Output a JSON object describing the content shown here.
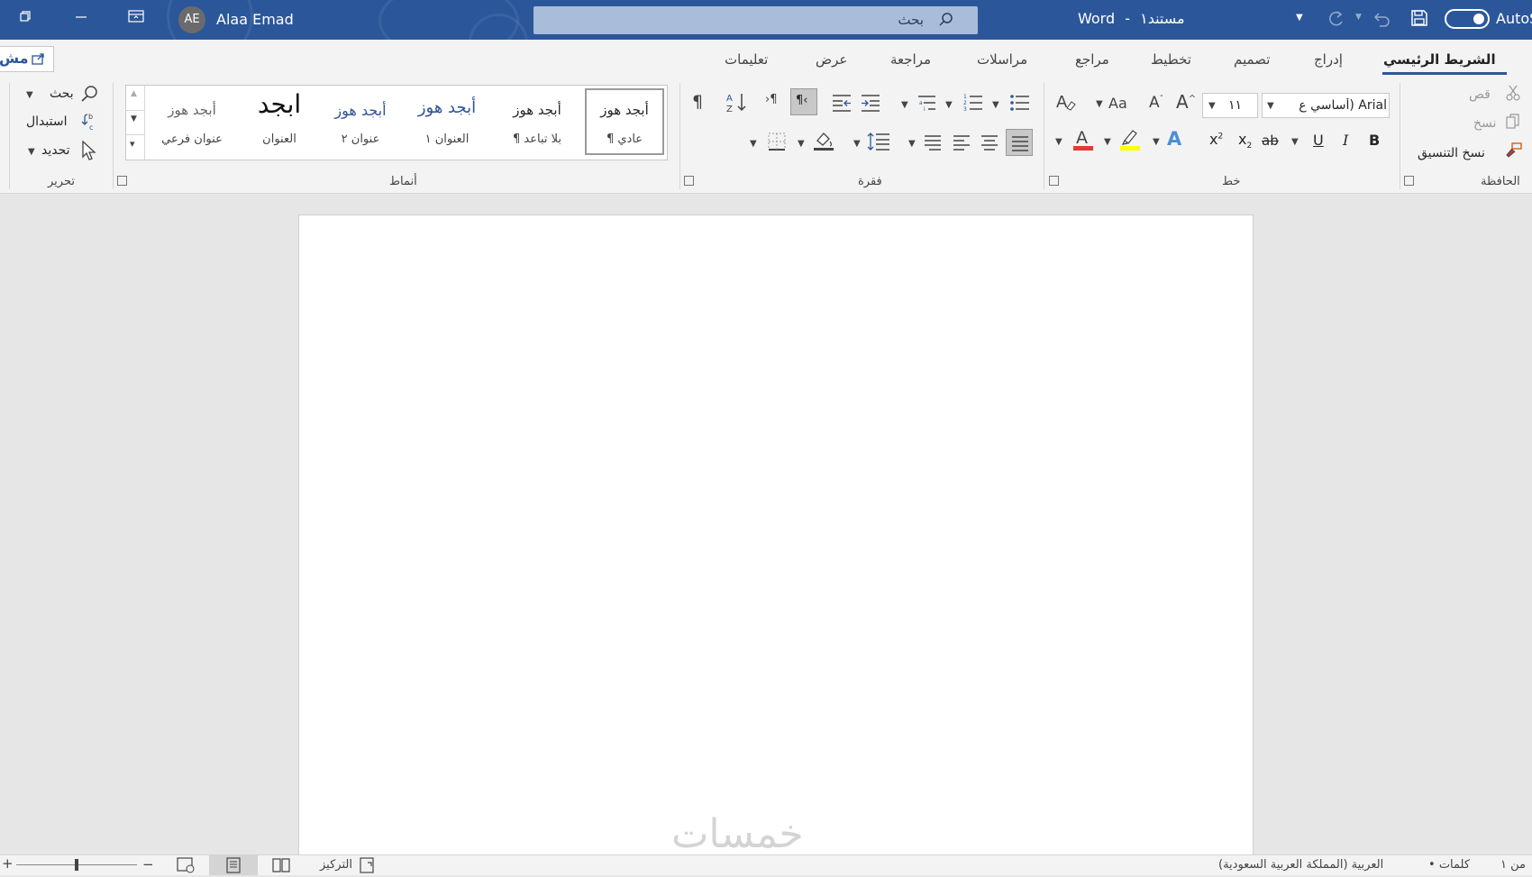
{
  "titlebar": {
    "user_initials": "AE",
    "user_name": "Alaa Emad",
    "search_placeholder": "بحث",
    "app_name": "Word",
    "doc_name": "مستند١",
    "title_sep": "-",
    "autosave_label": "AutoS",
    "share_label": "مش"
  },
  "tabs": [
    "الشريط الرئيسي",
    "إدراج",
    "تصميم",
    "تخطيط",
    "مراجع",
    "مراسلات",
    "مراجعة",
    "عرض",
    "تعليمات"
  ],
  "ribbon": {
    "clipboard": {
      "label": "الحافظة",
      "cut": "قص",
      "copy": "نسخ",
      "format_painter": "نسخ التنسيق"
    },
    "font": {
      "label": "خط",
      "font_name": "Arial (أساسي ع",
      "font_size": "١١",
      "grow": "A",
      "shrink": "A",
      "change_case": "Aa",
      "bold": "B",
      "italic": "I",
      "underline": "U",
      "strike": "ab",
      "subscript": "x",
      "superscript": "x",
      "highlight_color": "#ffff00",
      "font_color": "#e03c31"
    },
    "paragraph": {
      "label": "فقرة",
      "pilcrow": "¶"
    },
    "styles": {
      "label": "أنماط",
      "items": [
        {
          "preview": "أبجد هوز",
          "name": "¶ عادي"
        },
        {
          "preview": "أبجد هوز",
          "name": "¶ بلا تباعد"
        },
        {
          "preview": "أبجد هوز",
          "name": "العنوان ١"
        },
        {
          "preview": "أبجد هوز",
          "name": "عنوان ٢"
        },
        {
          "preview": "ابجد",
          "name": "العنوان"
        },
        {
          "preview": "أبجد هوز",
          "name": "عنوان فرعي"
        }
      ]
    },
    "editing": {
      "label": "تحرير",
      "find": "بحث",
      "replace": "استبدال",
      "select": "تحديد"
    }
  },
  "statusbar": {
    "page": "من ١",
    "words": "• كلمات",
    "language": "العربية (المملكة العربية السعودية)",
    "focus": "التركيز",
    "zoom_minus": "−",
    "zoom_plus": "+",
    "zoom_level": 0.5
  },
  "watermark": "خمسات",
  "colors": {
    "titlebar": "#2b579a",
    "ribbon": "#f3f3f3",
    "canvas": "#e6e6e6",
    "accent": "#2b579a"
  }
}
